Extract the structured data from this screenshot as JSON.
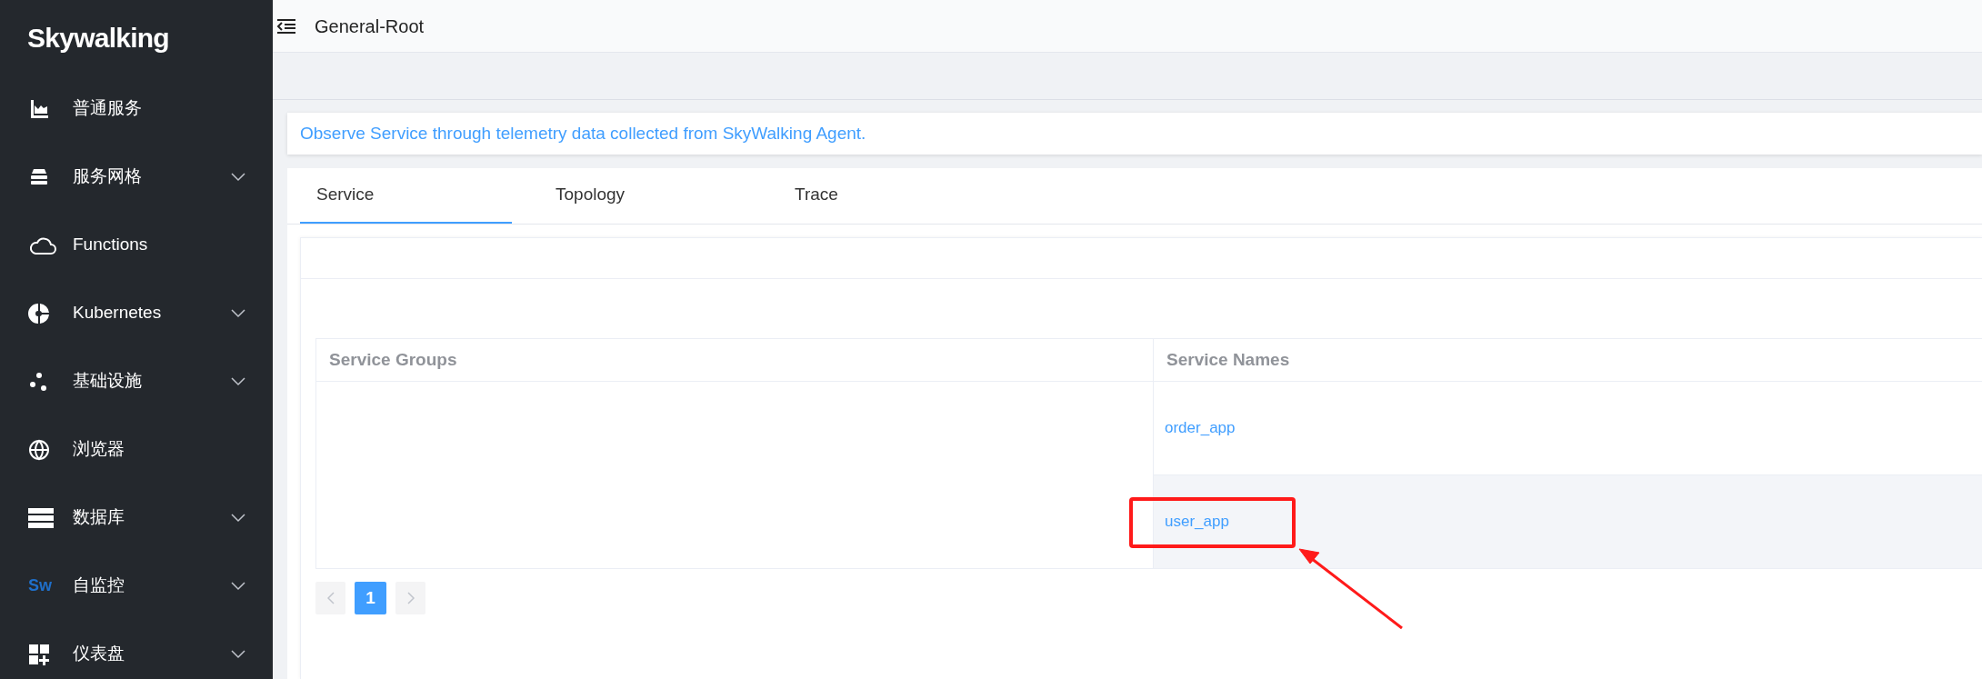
{
  "sidebar": {
    "logo": "Skywalking",
    "items": [
      {
        "label": "普通服务",
        "expandable": false
      },
      {
        "label": "服务网格",
        "expandable": true
      },
      {
        "label": "Functions",
        "expandable": false
      },
      {
        "label": "Kubernetes",
        "expandable": true
      },
      {
        "label": "基础设施",
        "expandable": true
      },
      {
        "label": "浏览器",
        "expandable": false
      },
      {
        "label": "数据库",
        "expandable": true
      },
      {
        "label": "自监控",
        "expandable": true,
        "logo_text": "Sw"
      },
      {
        "label": "仪表盘",
        "expandable": true
      }
    ]
  },
  "header": {
    "title": "General-Root"
  },
  "info": "Observe Service through telemetry data collected from SkyWalking Agent.",
  "tabs": [
    {
      "label": "Service",
      "selected": true
    },
    {
      "label": "Topology",
      "selected": false
    },
    {
      "label": "Trace",
      "selected": false
    }
  ],
  "table": {
    "columns": [
      "Service Groups",
      "Service Names"
    ],
    "rows": [
      {
        "service": "order_app",
        "highlighted": false
      },
      {
        "service": "user_app",
        "highlighted": true
      }
    ]
  },
  "pagination": {
    "prev_disabled": true,
    "next_disabled": true,
    "pages": [
      {
        "label": "1",
        "selected": true
      }
    ]
  }
}
